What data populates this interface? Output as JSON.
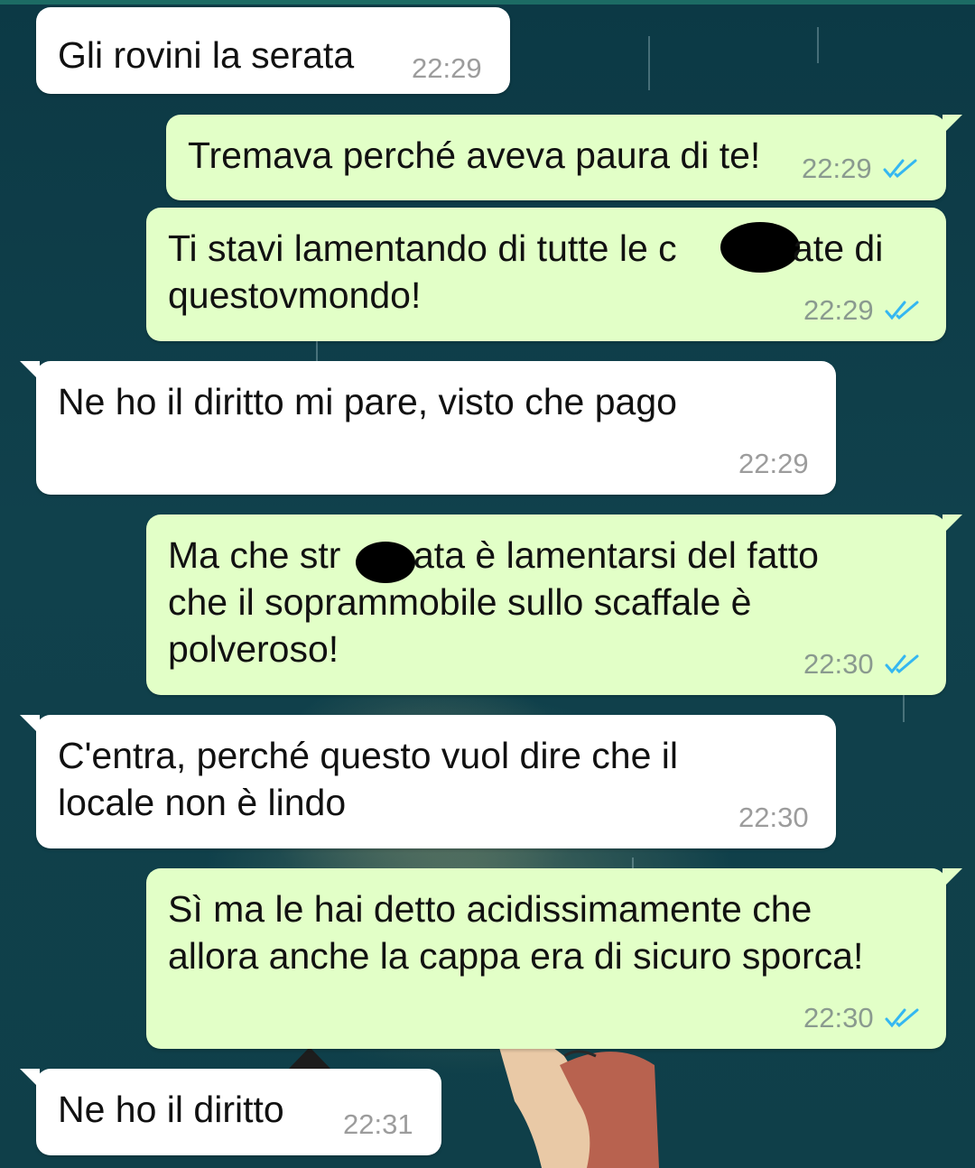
{
  "chat": {
    "messages": [
      {
        "direction": "incoming",
        "text_lines": [
          "Gli rovini la serata"
        ],
        "time": "22:29"
      },
      {
        "direction": "outgoing",
        "text_lines": [
          "Tremava perché aveva paura di te!"
        ],
        "time": "22:29",
        "status": "read"
      },
      {
        "direction": "outgoing",
        "text_lines": [
          "Ti stavi lamentando di tutte le c",
          "ate di",
          "questovmondo!"
        ],
        "time": "22:29",
        "status": "read",
        "redacted": true
      },
      {
        "direction": "incoming",
        "text_lines": [
          "Ne ho il diritto mi pare, visto che pago"
        ],
        "time": "22:29"
      },
      {
        "direction": "outgoing",
        "text_lines": [
          "Ma che str",
          "ata è lamentarsi del fatto",
          "che il soprammobile sullo scaffale è",
          "polveroso!"
        ],
        "time": "22:30",
        "status": "read",
        "redacted": true
      },
      {
        "direction": "incoming",
        "text_lines": [
          "C'entra, perché questo vuol dire che il",
          "locale non è lindo"
        ],
        "time": "22:30"
      },
      {
        "direction": "outgoing",
        "text_lines": [
          "Sì ma le hai detto acidissimamente che",
          "allora anche la cappa era di sicuro sporca!"
        ],
        "time": "22:30",
        "status": "read"
      },
      {
        "direction": "incoming",
        "text_lines": [
          "Ne ho il diritto"
        ],
        "time": "22:31"
      }
    ]
  },
  "colors": {
    "incoming_bubble": "#ffffff",
    "outgoing_bubble": "#e2ffc7",
    "read_ticks": "#34b7f1",
    "wallpaper": "#0f3d48"
  },
  "icons": {
    "read_status": "double-check-icon"
  }
}
